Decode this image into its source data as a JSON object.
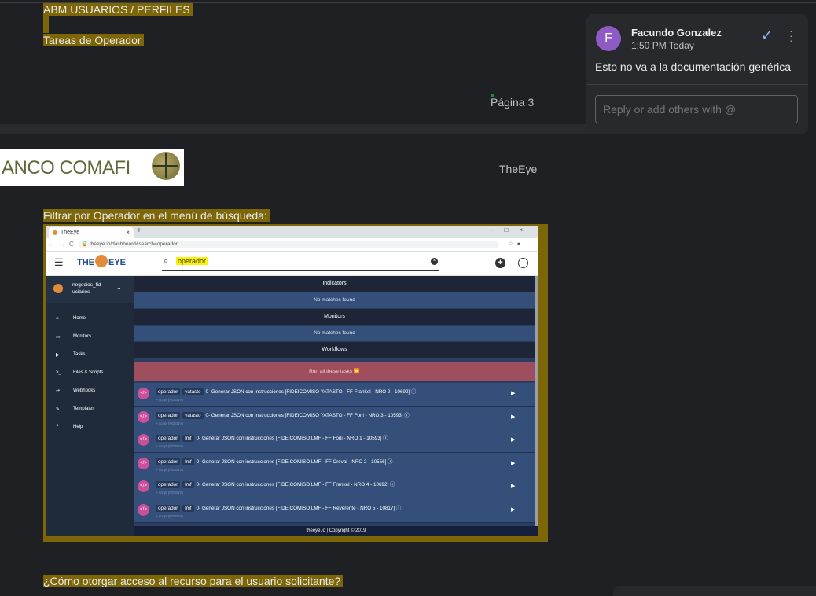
{
  "doc": {
    "heading": "ABM USUARIOS / PERFILES",
    "subheading": "Tareas de Operador",
    "page_label": "Página 3",
    "logo_text": "ANCO COMAFI",
    "header_right": "TheEye",
    "caption": "Filtrar por Operador en el menú de búsqueda:",
    "question": "¿Cómo otorgar acceso al recurso para el usuario solicitante?"
  },
  "screenshot": {
    "tab_title": "TheEye",
    "url": "theeye.io/dashboard#search=operador",
    "logo_left": "THE",
    "logo_right": "EYE",
    "search_query": "operador",
    "sidebar_user": "negocios_fid uciarios",
    "sidebar_items": [
      {
        "label": "Home",
        "icon": "home-icon"
      },
      {
        "label": "Monitors",
        "icon": "monitor-icon"
      },
      {
        "label": "Tasks",
        "icon": "play-icon"
      },
      {
        "label": "Files & Scripts",
        "icon": "terminal-icon"
      },
      {
        "label": "Webhooks",
        "icon": "webhook-icon"
      },
      {
        "label": "Templates",
        "icon": "wrench-icon"
      },
      {
        "label": "Help",
        "icon": "help-icon"
      }
    ],
    "sections": {
      "indicators": "Indicators",
      "indicators_empty": "No matches found",
      "monitors": "Monitors",
      "monitors_empty": "No matches found",
      "workflows": "Workflows",
      "run_all": "Run all these tasks"
    },
    "tasks": [
      {
        "tag1": "operador",
        "tag2": "yatasto",
        "title": "0- Generar JSON con instrucciones [FIDEICOMISO YATASTO - FF Frankel - NRO 2 - 10692]",
        "sub": "> script (NOENV)"
      },
      {
        "tag1": "operador",
        "tag2": "yatasto",
        "title": "0- Generar JSON con instrucciones [FIDEICOMISO YATASTO - FF Forli - NRO 3 - 10593]",
        "sub": "> script (NOENV)"
      },
      {
        "tag1": "operador",
        "tag2": "lmf",
        "title": "0- Generar JSON con instrucciones [FIDEICOMISO LMF - FF Forli - NRO 1 - 10593]",
        "sub": "> script (NOENV)"
      },
      {
        "tag1": "operador",
        "tag2": "lmf",
        "title": "0- Generar JSON con instrucciones [FIDEICOMISO LMF - FF Creval - NRO 2 - 10556]",
        "sub": "> script (NOENV)"
      },
      {
        "tag1": "operador",
        "tag2": "lmf",
        "title": "0- Generar JSON con instrucciones [FIDEICOMISO LMF - FF Frankel - NRO 4 - 10692]",
        "sub": "> script (NOENV)"
      },
      {
        "tag1": "operador",
        "tag2": "lmf",
        "title": "0- Generar JSON con instrucciones [FIDEICOMISO LMF - FF Reverente - NRO 5 - 10817]",
        "sub": "> script (NOENV)"
      }
    ],
    "footer": "theeye.io | Copyright © 2019"
  },
  "comment": {
    "avatar_letter": "F",
    "author": "Facundo Gonzalez",
    "time": "1:50 PM Today",
    "text": "Esto no va a la documentación genérica",
    "reply_placeholder": "Reply or add others with @",
    "accent": "#8ab4f8",
    "avatar_color": "#8e5ac4"
  }
}
